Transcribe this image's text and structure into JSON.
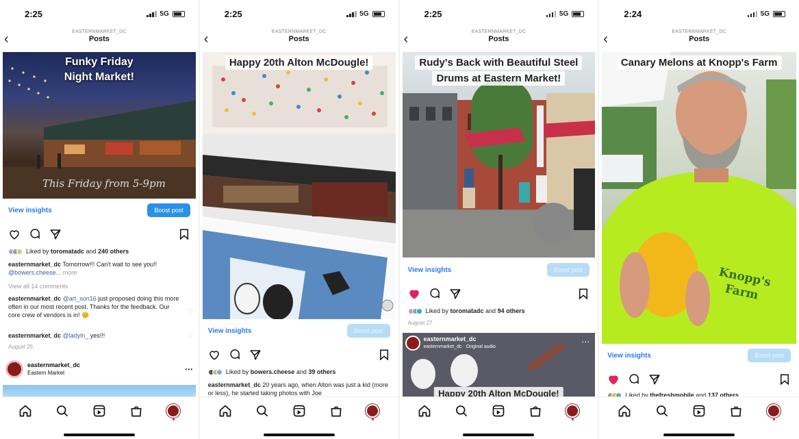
{
  "status": {
    "panel1_time": "2:25",
    "panel2_time": "2:25",
    "panel3_time": "2:25",
    "panel4_time": "2:24",
    "network": "5G"
  },
  "header": {
    "account": "EASTERNMARKET_DC",
    "title": "Posts"
  },
  "insights_label": "View insights",
  "boost_label": "Boost post",
  "panel1": {
    "overlay_lines": [
      "Funky Friday",
      "Night Market!"
    ],
    "script_text": "This Friday from 5-9pm",
    "liked_user": "toromatadc",
    "liked_others": "240 others",
    "caption_user": "easternmarket_dc",
    "caption_text": "Tomorrow!!! Can't wait to see you!!",
    "caption_line2": "@bowers.cheese...",
    "more": "more",
    "view_comments": "View all 14 comments",
    "comment1_user": "easternmarket_dc",
    "comment1_mention": "@art_son16",
    "comment1_text": "just proposed doing this more often in our most recent post. Thanks for the feedback. Our core crew of vendors is in! 😊",
    "comment2_user": "easternmarket_dc",
    "comment2_mention": "@ladyln_",
    "comment2_text": "yes!!!",
    "date": "August 25",
    "next_user": "easternmarket_dc",
    "next_sub": "Eastern Market"
  },
  "panel2": {
    "overlay_lines": [
      "Happy 20th Alton McDougle!"
    ],
    "liked_user": "bowers.cheese",
    "liked_others": "39 others",
    "caption_user": "easternmarket_dc",
    "caption_text": "20 years ago, when Alton was just a kid (more or less), he started taking photos with Joe"
  },
  "panel3": {
    "overlay_lines": [
      "Rudy's Back with Beautiful Steel",
      "Drums at Eastern Market!"
    ],
    "liked_user": "toromatadc",
    "liked_others": "94 others",
    "date": "August 27",
    "reel_user": "easternmarket_dc",
    "reel_audio": "easternmarket_dc · Original audio",
    "reel_overlay": "Happy 20th Alton McDougle!"
  },
  "panel4": {
    "overlay_lines": [
      "Canary Melons at Knopp's Farm"
    ],
    "shirt_text": [
      "Knopp's",
      "Farm"
    ],
    "liked_user": "thefreshmobile",
    "liked_others": "137 others"
  },
  "colors": {
    "accent_blue": "#2a90e8",
    "link_blue": "#2a7ae2",
    "liked_red": "#e0245e",
    "brand_maroon": "#8b1b1b",
    "shirt_green": "#b6ec1f"
  },
  "icons": [
    "chevron-left-icon",
    "heart-icon",
    "comment-icon",
    "share-icon",
    "bookmark-icon",
    "home-icon",
    "search-icon",
    "reels-icon",
    "shop-icon",
    "profile-icon"
  ]
}
